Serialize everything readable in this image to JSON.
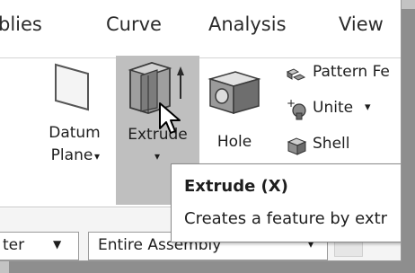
{
  "menu": {
    "items": [
      "blies",
      "Curve",
      "Analysis",
      "View"
    ]
  },
  "ribbon": {
    "datum_plane": {
      "line1": "Datum",
      "line2": "Plane",
      "arrow": "▾"
    },
    "extrude": {
      "label": "Extrude",
      "arrow": "▾"
    },
    "hole": {
      "label": "Hole"
    },
    "pattern_feature": {
      "label": "Pattern Fe"
    },
    "unite": {
      "label": "Unite",
      "arrow": "▾"
    },
    "shell": {
      "label": "Shell"
    }
  },
  "tooltip": {
    "title": "Extrude (X)",
    "description": "Creates a feature by extr"
  },
  "filterbar": {
    "filter_label": "ter",
    "filter_arrow": "▼",
    "scope_value": "Entire Assembly",
    "scope_arrow": "▾"
  },
  "colors": {
    "background": "#fafafa",
    "highlight": "#bfbfbf",
    "border": "#9a9a9a",
    "shadow": "#8e8e8e"
  },
  "icons": [
    "datum-plane-icon",
    "extrude-icon",
    "hole-icon",
    "pattern-feature-icon",
    "unite-icon",
    "shell-icon",
    "mouse-cursor-icon",
    "dropdown-arrow-icon"
  ]
}
